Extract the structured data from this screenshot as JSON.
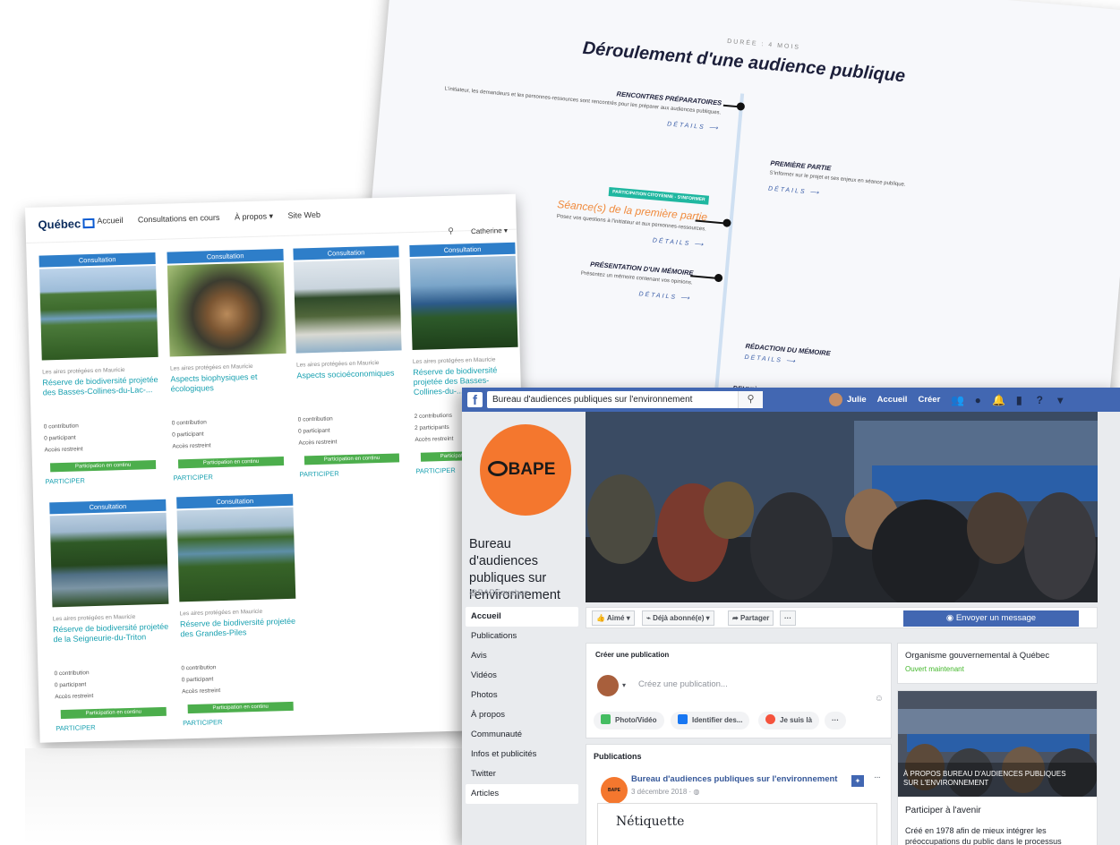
{
  "timeline": {
    "duree": "DURÉE : 4 MOIS",
    "title": "Déroulement d'une audience publique",
    "details": "DÉTAILS ⟶",
    "items": [
      {
        "title": "RENCONTRES PRÉPARATOIRES",
        "desc": "L'initiateur, les demandeurs et les personnes-ressources sont rencontrés pour les préparer aux audiences publiques."
      },
      {
        "title": "PREMIÈRE PARTIE",
        "desc": "S'informer sur le projet et ses enjeux en séance publique."
      },
      {
        "tag": "PARTICIPATION CITOYENNE - S'INFORMER",
        "title": "Séance(s) de la première partie",
        "desc": "Posez vos questions à l'initiateur et aux personnes-ressources."
      },
      {
        "title": "PRÉSENTATION D'UN MÉMOIRE",
        "desc": "Présentez un mémoire contenant vos opinions."
      },
      {
        "title": "RÉDACTION DU MÉMOIRE"
      },
      {
        "title": "DEUXIÈME PARTIE"
      }
    ]
  },
  "quebec": {
    "logo": "Québec",
    "nav": [
      "Accueil",
      "Consultations en cours",
      "À propos ▾",
      "Site Web"
    ],
    "user": "Catherine ▾",
    "header_label": "Consultation",
    "pill_label": "Participation en continu",
    "participate_label": "PARTICIPER",
    "region": "Les aires protégées en Mauricie",
    "cards": [
      {
        "title": "Réserve de biodiversité projetée des Basses-Collines-du-Lac-...",
        "contrib": "0 contribution",
        "part": "0 participant",
        "acces": "Accès restreint"
      },
      {
        "title": "Aspects biophysiques et écologiques",
        "contrib": "0 contribution",
        "part": "0 participant",
        "acces": "Accès restreint"
      },
      {
        "title": "Aspects socioéconomiques",
        "contrib": "0 contribution",
        "part": "0 participant",
        "acces": "Accès restreint"
      },
      {
        "title": "Réserve de biodiversité projetée des Basses-Collines-du-...",
        "contrib": "2 contributions",
        "part": "2 participants",
        "acces": "Accès restreint"
      },
      {
        "title": "Réserve de biodiversité projetée de la Seigneurie-du-Triton",
        "contrib": "0 contribution",
        "part": "0 participant",
        "acces": "Accès restreint"
      },
      {
        "title": "Réserve de biodiversité projetée des Grandes-Piles",
        "contrib": "0 contribution",
        "part": "0 participant",
        "acces": "Accès restreint"
      }
    ]
  },
  "facebook": {
    "search_value": "Bureau d'audiences publiques sur l'environnement",
    "nav": {
      "user": "Julie",
      "home": "Accueil",
      "create": "Créer"
    },
    "page_name": "Bureau d'audiences publiques sur l'environnement",
    "handle": "@BAPEquebec",
    "logo_text": "BAPE",
    "menu": [
      "Accueil",
      "Publications",
      "Avis",
      "Vidéos",
      "Photos",
      "À propos",
      "Communauté",
      "Infos et publicités",
      "Twitter",
      "Articles"
    ],
    "actions": {
      "liked": "Aimé ▾",
      "following": "Déjà abonné(e) ▾",
      "share": "Partager",
      "more": "···",
      "message": "Envoyer un message"
    },
    "create_post": {
      "title": "Créer une publication",
      "placeholder": "Créez une publication...",
      "photo": "Photo/Vidéo",
      "tag": "Identifier des...",
      "checkin": "Je suis là",
      "more": "···"
    },
    "publications": {
      "title": "Publications",
      "author": "Bureau d'audiences publiques sur l'environnement",
      "date": "3 décembre 2018 · ",
      "post_title": "Nétiquette"
    },
    "right": {
      "org": "Organisme gouvernemental à Québec",
      "open": "Ouvert maintenant",
      "about_caption": "À PROPOS BUREAU D'AUDIENCES PUBLIQUES SUR L'ENVIRONNEMENT",
      "future": "Participer à l'avenir",
      "desc": "Créé en 1978 afin de mieux intégrer les préoccupations du public dans le processus"
    }
  },
  "colors": {
    "fb_blue": "#4267b2",
    "bape_orange": "#f4772e",
    "qc_blue": "#2e7ec9",
    "pill_green": "#4cae4c"
  }
}
